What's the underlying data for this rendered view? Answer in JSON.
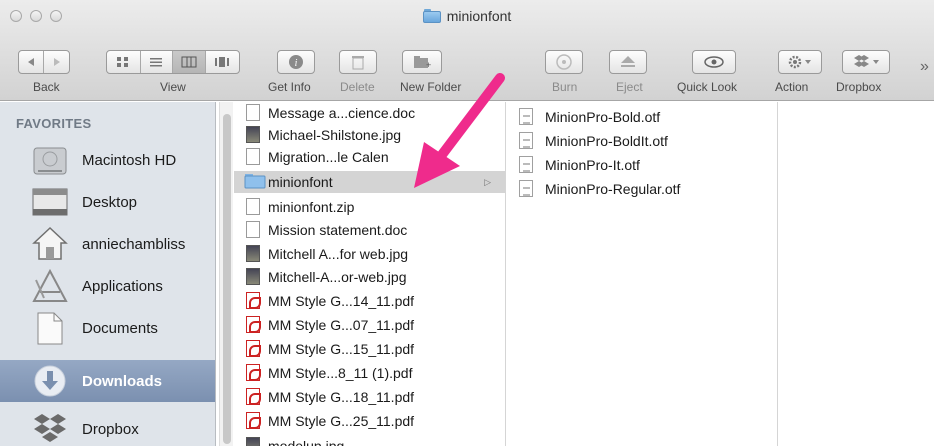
{
  "window": {
    "title": "minionfont"
  },
  "toolbar": {
    "labels": {
      "back": "Back",
      "view": "View",
      "get_info": "Get Info",
      "delete": "Delete",
      "new_folder": "New Folder",
      "burn": "Burn",
      "eject": "Eject",
      "quick_look": "Quick Look",
      "action": "Action",
      "dropbox": "Dropbox"
    },
    "overflow": "»"
  },
  "sidebar": {
    "header": "FAVORITES",
    "items": [
      {
        "label": "Macintosh HD",
        "icon": "hard-drive-icon"
      },
      {
        "label": "Desktop",
        "icon": "desktop-icon"
      },
      {
        "label": "anniechambliss",
        "icon": "home-icon"
      },
      {
        "label": "Applications",
        "icon": "applications-icon"
      },
      {
        "label": "Documents",
        "icon": "documents-icon"
      },
      {
        "label": "Downloads",
        "icon": "downloads-icon",
        "selected": true
      },
      {
        "label": "Dropbox",
        "icon": "dropbox-icon"
      }
    ]
  },
  "column1": {
    "items": [
      {
        "name": "Message a...cience.doc",
        "type": "doc"
      },
      {
        "name": "Michael-Shilstone.jpg",
        "type": "jpg"
      },
      {
        "name": "Migration...le Calen",
        "type": "doc"
      },
      {
        "name": "minionfont",
        "type": "folder",
        "selected": true
      },
      {
        "name": "minionfont.zip",
        "type": "zip"
      },
      {
        "name": "Mission statement.doc",
        "type": "doc"
      },
      {
        "name": "Mitchell A...for web.jpg",
        "type": "jpg"
      },
      {
        "name": "Mitchell-A...or-web.jpg",
        "type": "jpg"
      },
      {
        "name": "MM Style G...14_11.pdf",
        "type": "pdf"
      },
      {
        "name": "MM Style G...07_11.pdf",
        "type": "pdf"
      },
      {
        "name": "MM Style G...15_11.pdf",
        "type": "pdf"
      },
      {
        "name": "MM Style...8_11 (1).pdf",
        "type": "pdf"
      },
      {
        "name": "MM Style G...18_11.pdf",
        "type": "pdf"
      },
      {
        "name": "MM Style G...25_11.pdf",
        "type": "pdf"
      },
      {
        "name": "modelup.jpg",
        "type": "jpg"
      }
    ]
  },
  "column2": {
    "items": [
      {
        "name": "MinionPro-Bold.otf",
        "type": "font"
      },
      {
        "name": "MinionPro-BoldIt.otf",
        "type": "font"
      },
      {
        "name": "MinionPro-It.otf",
        "type": "font"
      },
      {
        "name": "MinionPro-Regular.otf",
        "type": "font"
      }
    ]
  },
  "colors": {
    "arrow": "#ef2b8c",
    "sidebar_bg": "#dfe4ea",
    "sidebar_selected": "#8599b8",
    "folder_blue": "#7eb3e4"
  }
}
